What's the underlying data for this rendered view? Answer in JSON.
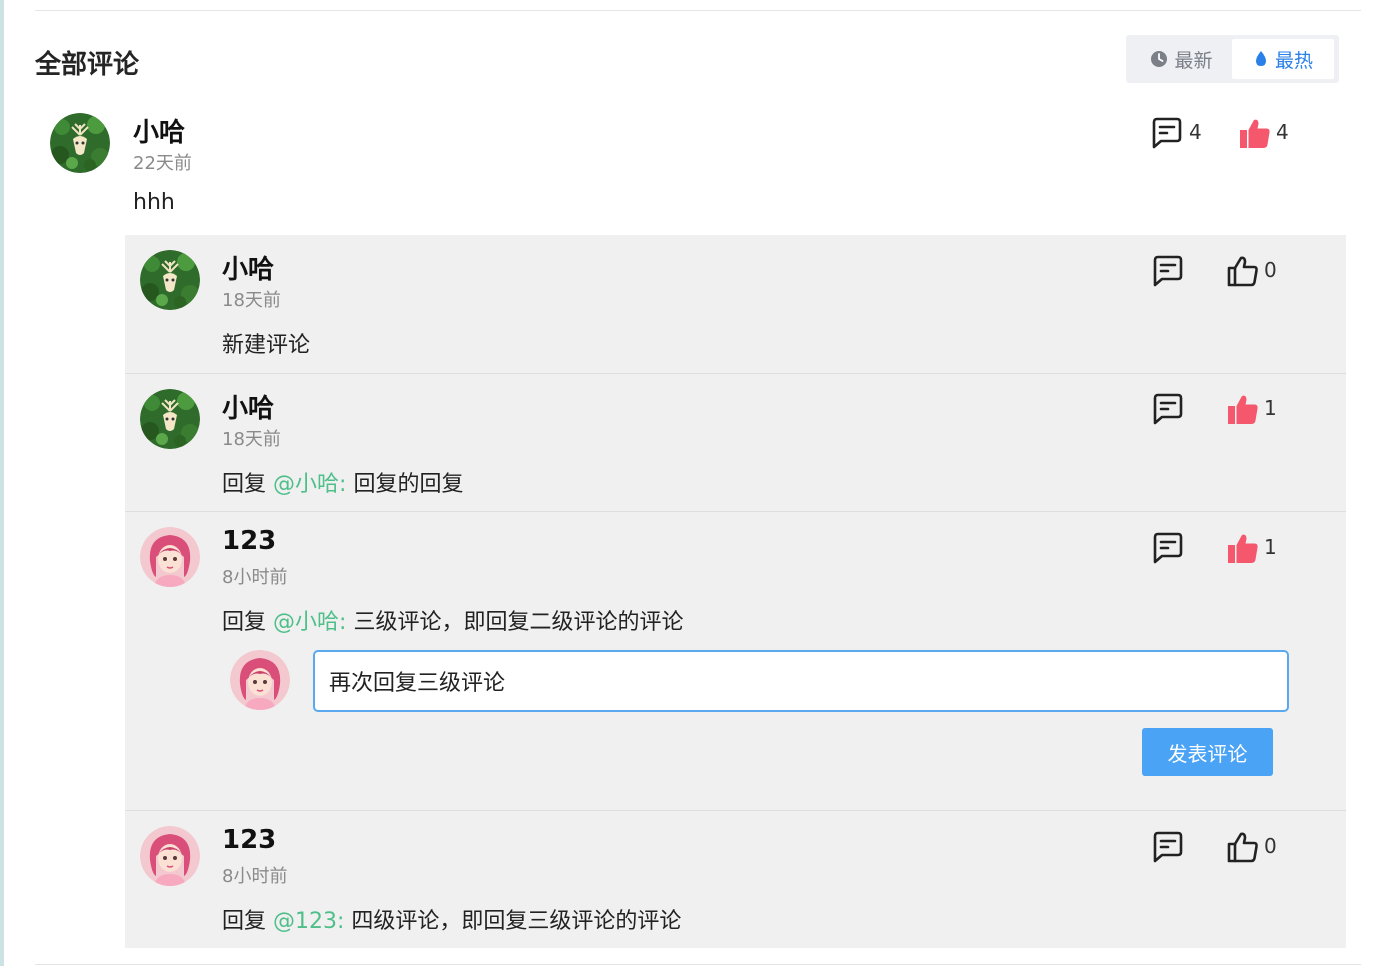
{
  "section": {
    "title": "全部评论"
  },
  "sort": {
    "latest_label": "最新",
    "hot_label": "最热",
    "active": "hot"
  },
  "colors": {
    "accent": "#2a80e8",
    "mention": "#4fbf8a",
    "liked": "#f5576c",
    "input_border": "#5aa9ee",
    "button": "#4aa3f5"
  },
  "root_comment": {
    "user": "小哈",
    "time": "22天前",
    "content": "hhh",
    "reply_count": "4",
    "like_count": "4",
    "liked": true,
    "avatar": "deer-avatar"
  },
  "replies": [
    {
      "user": "小哈",
      "time": "18天前",
      "reply_prefix": "",
      "mention": "",
      "content": "新建评论",
      "like_count": "0",
      "liked": false,
      "avatar": "deer-avatar"
    },
    {
      "user": "小哈",
      "time": "18天前",
      "reply_prefix": "回复",
      "mention": "@小哈:",
      "content": "回复的回复",
      "like_count": "1",
      "liked": true,
      "avatar": "deer-avatar"
    },
    {
      "user": "123",
      "time": "8小时前",
      "reply_prefix": "回复",
      "mention": "@小哈:",
      "content": "三级评论，即回复二级评论的评论",
      "like_count": "1",
      "liked": true,
      "avatar": "girl-avatar"
    },
    {
      "user": "123",
      "time": "8小时前",
      "reply_prefix": "回复",
      "mention": "@123:",
      "content": "四级评论，即回复三级评论的评论",
      "like_count": "0",
      "liked": false,
      "avatar": "girl-avatar"
    }
  ],
  "reply_form": {
    "value": "再次回复三级评论",
    "submit_label": "发表评论",
    "avatar": "girl-avatar"
  }
}
